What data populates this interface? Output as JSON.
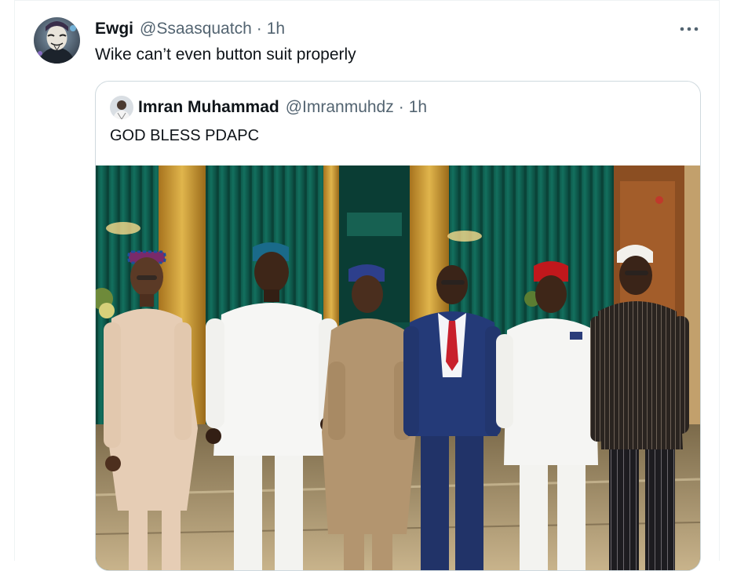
{
  "tweet": {
    "author_name": "Ewgi",
    "author_handle": "@Ssaasquatch",
    "separator": "·",
    "time": "1h",
    "text": "Wike can’t even button suit properly",
    "avatar_icon": "masked-face-avatar",
    "more_icon": "more-horizontal-icon"
  },
  "quoted_tweet": {
    "author_name": "Imran Muhammad",
    "author_handle": "@Imranmuhdz",
    "separator": "·",
    "time": "1h",
    "text": "GOD BLESS PDAPC",
    "avatar_icon": "user-avatar",
    "media_icon": "group-photo-image"
  },
  "colors": {
    "text_primary": "#0f1419",
    "text_secondary": "#536471",
    "border": "#cfd9de",
    "curtain_green": "#0e5a4c",
    "gold_wall": "#c8962e"
  }
}
